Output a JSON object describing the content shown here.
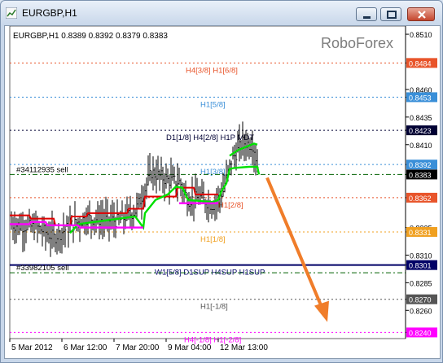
{
  "window": {
    "title": "EURGBP,H1",
    "minimize_icon": "minimize-icon",
    "maximize_icon": "restore-icon",
    "close_icon": "close-icon"
  },
  "chart_header": "EURGBP,H1  0.8389 0.8392 0.8379 0.8383",
  "watermark": "RoboForex",
  "colors": {
    "bull_line": "#00e000",
    "bear_line": "#e00000",
    "magenta_line": "#ff00ff",
    "arrow": "#f07d2a",
    "price_bars": "#000000"
  },
  "chart_data": {
    "type": "ohlc",
    "symbol": "EURGBP",
    "timeframe": "H1",
    "ohlc_header": {
      "open": 0.8389,
      "high": 0.8392,
      "low": 0.8379,
      "close": 0.8383
    },
    "ylim": [
      0.823,
      0.8513
    ],
    "y_ticks": [
      "0.8510",
      "0.8484",
      "0.8460",
      "0.8453",
      "0.8435",
      "0.8423",
      "0.8410",
      "0.8392",
      "0.8383",
      "0.8362",
      "0.8335",
      "0.8331",
      "0.8310",
      "0.8301",
      "0.8285",
      "0.8270",
      "0.8260",
      "0.8240"
    ],
    "x_ticks": [
      "5 Mar 2012",
      "6 Mar 12:00",
      "7 Mar 20:00",
      "9 Mar 04:00",
      "12 Mar 13:00"
    ],
    "levels": [
      {
        "label": "H4[3/8] H1[6/8]",
        "price": 0.8484,
        "color": "#e8542a",
        "style": "dotted",
        "tag": "0.8484"
      },
      {
        "label": "H1[5/8]",
        "price": 0.8453,
        "color": "#3a8fd8",
        "style": "dotted",
        "tag": "0.8453"
      },
      {
        "label": "D1[1/8] H4[2/8] H1P MDT",
        "price": 0.8423,
        "color": "#000033",
        "style": "dotted",
        "tag": "0.8423"
      },
      {
        "label": "H1[3/8]",
        "price": 0.8392,
        "color": "#3a8fd8",
        "style": "dotted",
        "tag": "0.8392"
      },
      {
        "label": "H1[2/8]",
        "price": 0.8362,
        "color": "#e8542a",
        "style": "dotted",
        "tag": "0.8362"
      },
      {
        "label": "H1[1/8]",
        "price": 0.8331,
        "color": "#f0a020",
        "style": "dotted",
        "tag": "0.8331"
      },
      {
        "label": "W1[5/8] D1SUP H4SUP H1SUP",
        "price": 0.8301,
        "color": "#000066",
        "style": "solid",
        "tag": "0.8301"
      },
      {
        "label": "H1[-1/8]",
        "price": 0.827,
        "color": "#555555",
        "style": "dotted",
        "tag": "0.8270"
      },
      {
        "label": "H4[-1/8] H1[-2/8]",
        "price": 0.824,
        "color": "#ff00ff",
        "style": "dotted",
        "tag": "0.8240"
      }
    ],
    "orders": [
      {
        "label": "#34112935 sell",
        "price": 0.8383,
        "tag": "0.8383"
      },
      {
        "label": "#33982105 sell",
        "price": 0.8294
      }
    ],
    "grid": false,
    "forecast_arrow": {
      "from_price": 0.8383,
      "to_price": 0.8245,
      "color": "#f07d2a"
    }
  }
}
